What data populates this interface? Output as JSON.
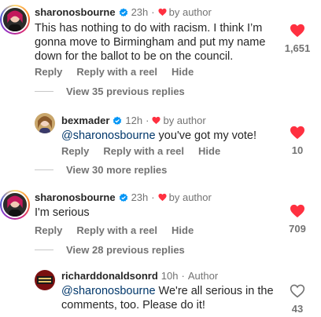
{
  "comments": [
    {
      "username": "sharonosbourne",
      "verified": true,
      "time": "23h",
      "by_author": "by author",
      "text": "This has nothing to do with racism. I think I’m gonna move to Birmingham and put my name down for the ballot to be on the council.",
      "reply_label": "Reply",
      "reel_label": "Reply with a reel",
      "hide_label": "Hide",
      "likes": "1,651",
      "liked": true,
      "view_replies": "View 35 previous replies"
    },
    {
      "username": "bexmader",
      "verified": true,
      "time": "12h",
      "by_author": "by author",
      "mention": "@sharonosbourne",
      "text": " you've got my vote!",
      "reply_label": "Reply",
      "reel_label": "Reply with a reel",
      "hide_label": "Hide",
      "likes": "10",
      "liked": true,
      "view_replies": "View 30 more replies"
    },
    {
      "username": "sharonosbourne",
      "verified": true,
      "time": "23h",
      "by_author": "by author",
      "text": "I'm serious",
      "reply_label": "Reply",
      "reel_label": "Reply with a reel",
      "hide_label": "Hide",
      "likes": "709",
      "liked": true,
      "view_replies": "View 28 previous replies"
    },
    {
      "username": "richarddonaldsonrd",
      "time": "10h",
      "author_label": "Author",
      "mention": "@sharonosbourne",
      "text": " We're all serious in the comments, too. Please do it!",
      "likes": "43",
      "liked": false
    }
  ],
  "colors": {
    "heart_red": "#ff3040",
    "verified_blue": "#0095f6",
    "mention_blue": "#00376b",
    "muted_gray": "#737373"
  },
  "icons": {
    "verified": "verified-badge-icon",
    "liked": "heart-filled-icon",
    "unliked": "heart-outline-icon",
    "by_author": "small-heart-icon"
  }
}
